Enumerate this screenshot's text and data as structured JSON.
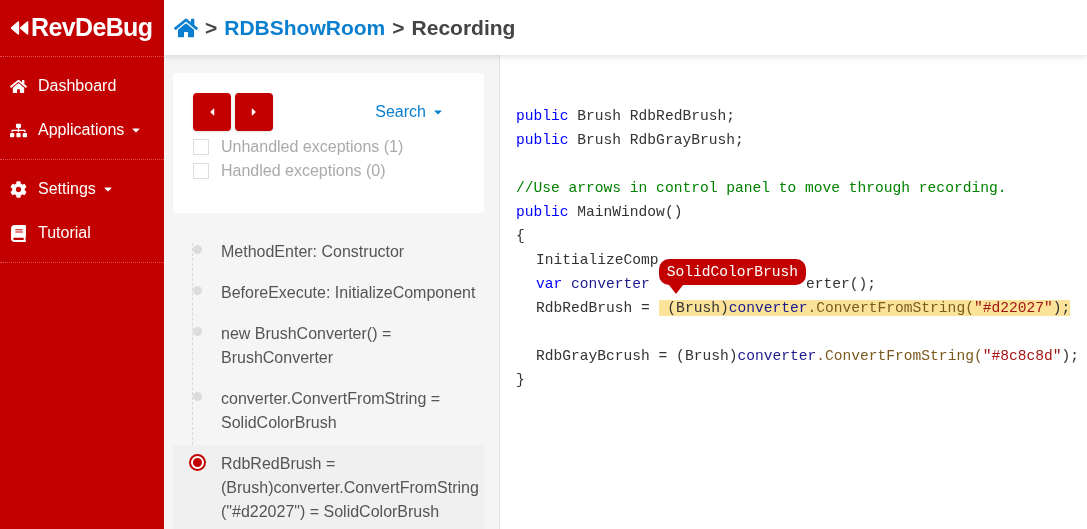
{
  "brand": {
    "logo": "RevDeBug"
  },
  "breadcrumb": [
    {
      "kind": "home"
    },
    {
      "kind": "link",
      "label": "RDBShowRoom"
    },
    {
      "kind": "current",
      "label": "Recording"
    }
  ],
  "separator": ">",
  "sidebar": {
    "groups": [
      [
        {
          "label": "Dashboard",
          "has_caret": false
        },
        {
          "label": "Applications",
          "has_caret": true
        }
      ],
      [
        {
          "label": "Settings",
          "has_caret": true
        },
        {
          "label": "Tutorial",
          "has_caret": false
        }
      ]
    ]
  },
  "controls": {
    "search_label": "Search",
    "filters": [
      {
        "label": "Unhandled exceptions (1)",
        "checked": false
      },
      {
        "label": "Handled exceptions (0)",
        "checked": false
      }
    ]
  },
  "timeline": [
    {
      "text": "MethodEnter: Constructor",
      "selected": false
    },
    {
      "text": "BeforeExecute: InitializeComponent",
      "selected": false
    },
    {
      "text": "new BrushConverter() = BrushConverter",
      "selected": false
    },
    {
      "text": "converter.ConvertFromString = SolidColorBrush",
      "selected": false
    },
    {
      "text": "RdbRedBrush = (Brush)converter.ConvertFromString (\"#d22027\") = SolidColorBrush",
      "selected": true
    }
  ],
  "code": [
    {
      "kind": "line",
      "tokens": [
        {
          "kind": "kw",
          "text": "public"
        },
        {
          "kind": "plain",
          "text": " Brush RdbRedBrush;"
        }
      ]
    },
    {
      "kind": "line",
      "tokens": [
        {
          "kind": "kw",
          "text": "public"
        },
        {
          "kind": "plain",
          "text": " Brush RdbGrayBrush;"
        }
      ]
    },
    {
      "kind": "blank"
    },
    {
      "kind": "line",
      "tokens": [
        {
          "kind": "comment",
          "text": "//Use arrows in control panel to move through recording."
        }
      ]
    },
    {
      "kind": "line",
      "tokens": [
        {
          "kind": "kw",
          "text": "public"
        },
        {
          "kind": "plain",
          "text": " MainWindow()"
        }
      ]
    },
    {
      "kind": "block",
      "open": "{",
      "close": "}",
      "children": [
        {
          "kind": "line",
          "tokens": [
            {
              "kind": "plain",
              "text": "InitializeComp"
            }
          ]
        },
        {
          "kind": "line",
          "tokens": [
            {
              "kind": "kw",
              "text": "var"
            },
            {
              "kind": "ident",
              "text": " converter "
            },
            {
              "kind": "tooltip",
              "text": "SolidColorBrush"
            },
            {
              "kind": "plain",
              "text": "erter();"
            }
          ]
        },
        {
          "kind": "line",
          "tokens": [
            {
              "kind": "plain",
              "text": "RdbRedBrush = "
            },
            {
              "kind": "plain",
              "text": " (Brush)",
              "highlighted": true
            },
            {
              "kind": "ident",
              "text": "converter",
              "highlighted": true
            },
            {
              "kind": "method",
              "text": ".ConvertFromString(",
              "highlighted": true
            },
            {
              "kind": "str",
              "text": "\"#d22027\"",
              "highlighted": true
            },
            {
              "kind": "plain",
              "text": ");",
              "highlighted": true
            }
          ]
        },
        {
          "kind": "blank"
        },
        {
          "kind": "line",
          "tokens": [
            {
              "kind": "plain",
              "text": "RdbGrayBcrush = (Brush)"
            },
            {
              "kind": "ident",
              "text": "converter"
            },
            {
              "kind": "method",
              "text": ".ConvertFromString("
            },
            {
              "kind": "str",
              "text": "\"#8c8c8d\""
            },
            {
              "kind": "plain",
              "text": ");"
            }
          ]
        }
      ]
    }
  ]
}
